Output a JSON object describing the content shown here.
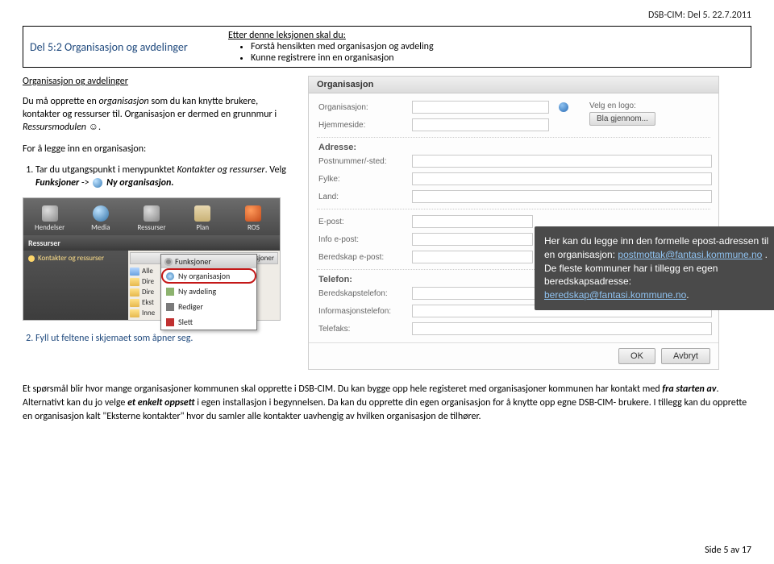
{
  "doc_header": "DSB-CIM: Del 5. 22.7.2011",
  "lesson": {
    "title": "Del 5:2 Organisasjon og avdelinger",
    "intro": "Etter denne leksjonen skal du:",
    "bullets": [
      "Forstå hensikten med organisasjon og avdeling",
      "Kunne registrere inn en organisasjon"
    ]
  },
  "section_title": "Organisasjon og avdelinger",
  "para1_a": "Du må opprette en ",
  "para1_b": "organisasjon",
  "para1_c": " som du kan knytte brukere, kontakter og ressurser til. Organisasjon er dermed en grunnmur i ",
  "para1_d": "Ressursmodulen",
  "para1_e": " ",
  "steps_intro": "For å legge inn en organisasjon:",
  "step1_a": "Tar du utgangspunkt i menypunktet ",
  "step1_b": "Kontakter og ressurser",
  "step1_c": ". Velg ",
  "step1_d": "Funksjoner",
  "step1_e": " -> ",
  "step1_f": "Ny organisasjon.",
  "step2": "Fyll ut feltene i skjemaet som åpner seg.",
  "miniapp": {
    "toolbar": [
      "Hendelser",
      "Media",
      "Ressurser",
      "Plan",
      "ROS"
    ],
    "subbar": "Ressurser",
    "sidelink": "Kontakter og ressurser",
    "funksjoner": "Funksjoner",
    "tree": [
      "Alle",
      "Dire",
      "Dire",
      "Ekst",
      "Inne"
    ],
    "popup": {
      "items": [
        "Ny organisasjon",
        "Ny avdeling",
        "Rediger",
        "Slett"
      ]
    }
  },
  "org": {
    "tab": "Organisasjon",
    "labels": {
      "org": "Organisasjon:",
      "home": "Hjemmeside:",
      "adr_h": "Adresse:",
      "post": "Postnummer/-sted:",
      "fylke": "Fylke:",
      "land": "Land:",
      "epost": "E-post:",
      "info": "Info e-post:",
      "bered": "Beredskap e-post:",
      "tlf_h": "Telefon:",
      "btlf": "Beredskapstelefon:",
      "itlf": "Informasjonstelefon:",
      "fax": "Telefaks:"
    },
    "logo_label": "Velg en logo:",
    "logo_btn": "Bla gjennom...",
    "ok": "OK",
    "cancel": "Avbryt"
  },
  "tooltip": {
    "t1": "Her kan du legge inn den formelle epost-adressen til en organisasjon: ",
    "link1": "postmottak@fantasi.kommune.no",
    "t2": " . De fleste kommuner har i tillegg en egen beredskapsadresse: ",
    "link2": "beredskap@fantasi.kommune.no",
    "t3": "."
  },
  "closing_a": "Et spørsmål blir hvor mange organisasjoner kommunen skal opprette i DSB-CIM. Du kan bygge opp hele registeret med organisasjoner kommunen har kontakt med ",
  "closing_b": "fra starten av",
  "closing_c": ". Alternativt kan du jo velge ",
  "closing_d": "et enkelt oppsett",
  "closing_e": " i egen installasjon i begynnelsen.  Da kan du opprette din egen organisasjon for å knytte opp egne DSB-CIM- brukere. I tillegg kan du opprette en organisasjon kalt \"Eksterne kontakter\" hvor du samler alle kontakter uavhengig av hvilken organisasjon de tilhører.",
  "footer": "Side 5 av 17"
}
